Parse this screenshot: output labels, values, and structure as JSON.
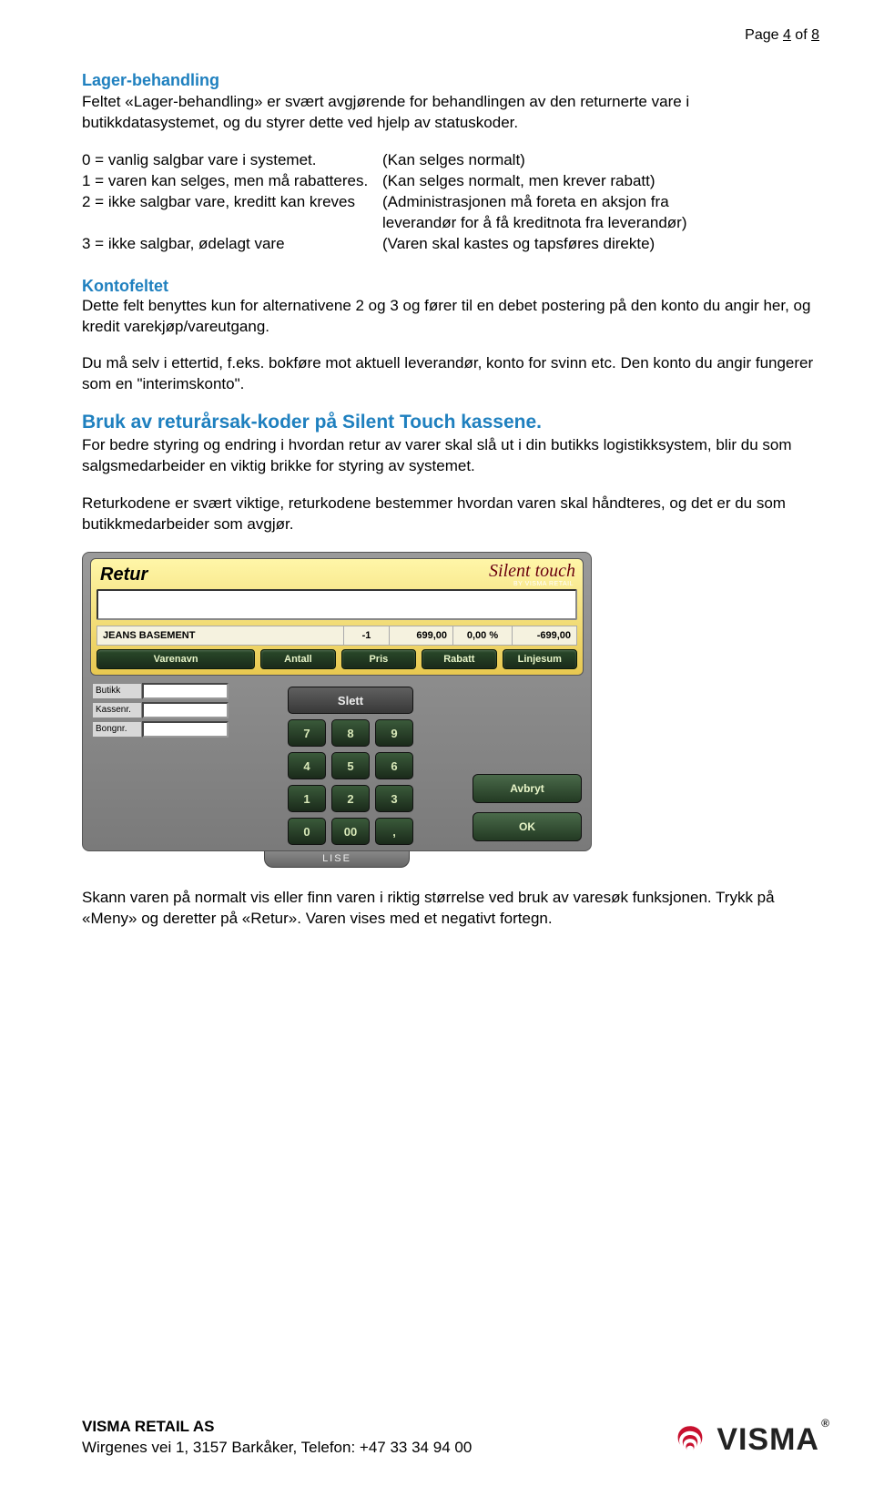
{
  "header": {
    "prefix": "Page ",
    "current": "4",
    "mid": " of ",
    "total": "8"
  },
  "section1": {
    "title": "Lager-behandling",
    "para": "Feltet «Lager-behandling» er svært avgjørende for behandlingen av den returnerte vare i butikkdatasystemet, og du styrer dette ved hjelp av statuskoder."
  },
  "codes": {
    "rows": [
      {
        "l": "0 = vanlig salgbar vare i systemet.",
        "r": "(Kan selges normalt)"
      },
      {
        "l": "1 = varen kan selges, men må rabatteres.",
        "r": "(Kan selges normalt, men krever rabatt)"
      },
      {
        "l": "2 = ikke salgbar vare, kreditt kan kreves",
        "r": "(Administrasjonen må foreta en aksjon fra"
      },
      {
        "l": "",
        "r": " leverandør for å få kreditnota fra leverandør)"
      },
      {
        "l": "3 = ikke salgbar, ødelagt vare",
        "r": "(Varen skal kastes og tapsføres direkte)"
      }
    ]
  },
  "section2": {
    "title": "Kontofeltet",
    "p1": "Dette felt benyttes kun for alternativene 2 og 3 og fører til en debet postering på den konto du angir her, og kredit varekjøp/vareutgang.",
    "p2": "Du må selv i ettertid, f.eks. bokføre mot aktuell leverandør, konto for svinn etc. Den konto du angir fungerer som en \"interimskonto\"."
  },
  "section3": {
    "title": "Bruk av returårsak-koder på Silent Touch kassene.",
    "p1": "For bedre styring og endring i hvordan retur av varer skal slå ut i din butikks logistikksystem, blir du som salgsmedarbeider en viktig brikke for styring av systemet.",
    "p2": "Returkodene er svært viktige, returkodene bestemmer hvordan varen skal håndteres, og det er du som butikkmedarbeider som avgjør."
  },
  "pos": {
    "title": "Retur",
    "logo": "Silent touch",
    "logo_sub": "BY VISMA RETAIL",
    "item": {
      "name": "JEANS BASEMENT",
      "qty": "-1",
      "price": "699,00",
      "disc": "0,00 %",
      "sum": "-699,00"
    },
    "cols": [
      "Varenavn",
      "Antall",
      "Pris",
      "Rabatt",
      "Linjesum"
    ],
    "left_fields": [
      "Butikk",
      "Kassenr.",
      "Bongnr."
    ],
    "slett": "Slett",
    "keypad": [
      "7",
      "8",
      "9",
      "4",
      "5",
      "6",
      "1",
      "2",
      "3",
      "0",
      "00",
      ","
    ],
    "avbryt": "Avbryt",
    "ok": "OK",
    "tab": "LISE"
  },
  "after": "Skann varen på normalt vis eller finn varen i riktig størrelse ved bruk av varesøk funksjonen. Trykk på «Meny» og deretter på «Retur». Varen vises med et negativt fortegn.",
  "footer": {
    "company": "VISMA RETAIL AS",
    "addr": "Wirgenes vei 1, 3157 Barkåker, Telefon: +47 33 34 94 00",
    "logo_text": "VISMA"
  }
}
